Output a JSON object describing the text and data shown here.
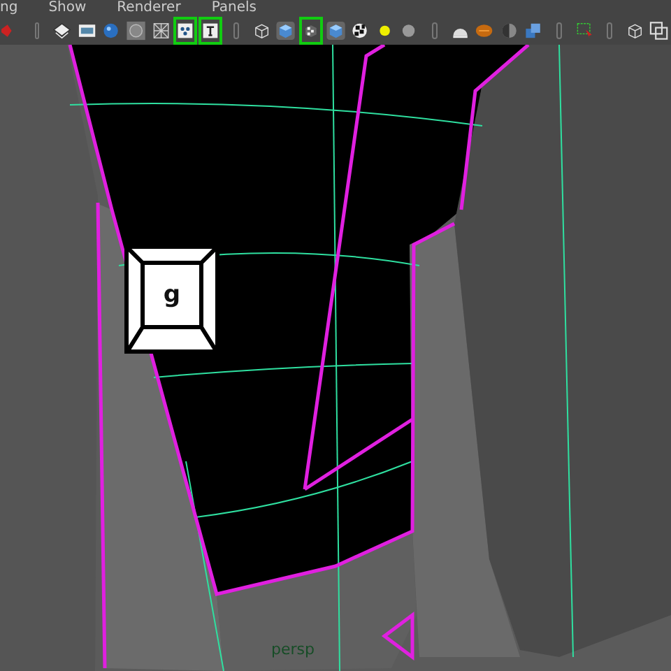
{
  "menu": [
    "ng",
    "Show",
    "Renderer",
    "Panels"
  ],
  "toolbar": [
    {
      "kind": "tool",
      "on": false
    },
    {
      "kind": "separator"
    },
    {
      "kind": "layers",
      "on": false
    },
    {
      "kind": "film",
      "on": false
    },
    {
      "kind": "sphere",
      "on": false
    },
    {
      "kind": "circle",
      "on": false
    },
    {
      "kind": "xray",
      "on": false
    },
    {
      "kind": "dots",
      "on": true
    },
    {
      "kind": "text",
      "on": true
    },
    {
      "kind": "separator"
    },
    {
      "kind": "wirecube",
      "on": false
    },
    {
      "kind": "cube",
      "on": false
    },
    {
      "kind": "checkcube",
      "on": true
    },
    {
      "kind": "cube",
      "on": false
    },
    {
      "kind": "checker",
      "on": false
    },
    {
      "kind": "bulb",
      "on": false
    },
    {
      "kind": "greybulb",
      "on": false
    },
    {
      "kind": "separator"
    },
    {
      "kind": "litsphere",
      "on": false
    },
    {
      "kind": "ball",
      "on": false
    },
    {
      "kind": "halfsphere",
      "on": false
    },
    {
      "kind": "cubes",
      "on": false
    },
    {
      "kind": "separator"
    },
    {
      "kind": "select",
      "on": false
    },
    {
      "kind": "separator"
    },
    {
      "kind": "wirecube",
      "on": false
    },
    {
      "kind": "frames",
      "on": false
    }
  ],
  "viewport": {
    "key_hint": "g",
    "camera": "persp"
  }
}
